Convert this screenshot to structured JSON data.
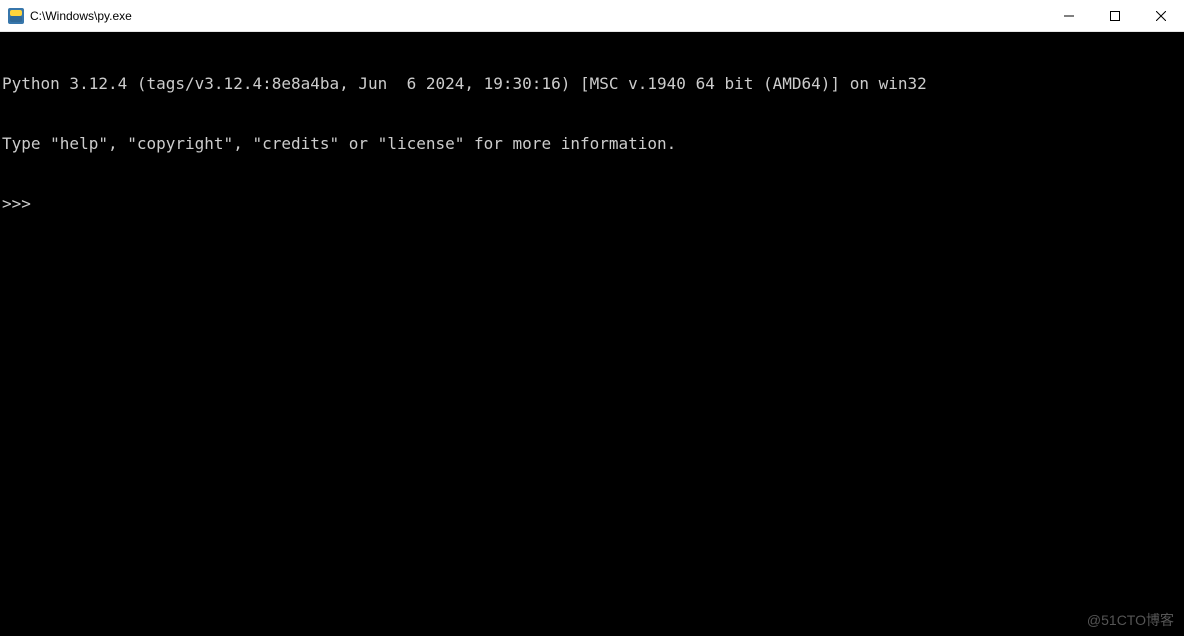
{
  "window": {
    "title": "C:\\Windows\\py.exe"
  },
  "terminal": {
    "line1": "Python 3.12.4 (tags/v3.12.4:8e8a4ba, Jun  6 2024, 19:30:16) [MSC v.1940 64 bit (AMD64)] on win32",
    "line2": "Type \"help\", \"copyright\", \"credits\" or \"license\" for more information.",
    "prompt": ">>>"
  },
  "watermark": "@51CTO博客"
}
